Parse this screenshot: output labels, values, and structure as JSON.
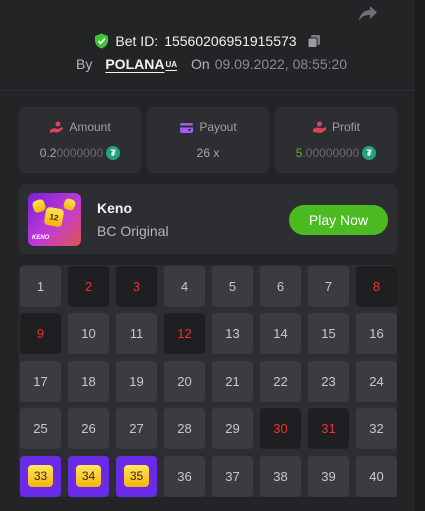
{
  "bet": {
    "id_label": "Bet ID:",
    "id_value": "15560206951915573",
    "by_label": "By",
    "user_name": "POLANA",
    "user_tag": "UA",
    "on_label": "On",
    "date": "09.09.2022, 08:55:20"
  },
  "stats": {
    "amount": {
      "label": "Amount",
      "value_main": "0.2",
      "value_zeros": "0000000",
      "coin": "₮"
    },
    "payout": {
      "label": "Payout",
      "value": "26 x"
    },
    "profit": {
      "label": "Profit",
      "value_main": "5",
      "value_zeros": ".00000000",
      "coin": "₮"
    }
  },
  "game": {
    "name": "Keno",
    "subtitle": "BC Original",
    "play_label": "Play Now",
    "thumb_label": "KENO",
    "thumb_tile": "12"
  },
  "keno": {
    "picked": [
      2,
      3,
      8,
      9,
      12,
      30,
      31
    ],
    "hits": [
      33,
      34,
      35
    ],
    "cells": [
      {
        "n": "1",
        "s": "normal"
      },
      {
        "n": "2",
        "s": "picked"
      },
      {
        "n": "3",
        "s": "picked"
      },
      {
        "n": "4",
        "s": "normal"
      },
      {
        "n": "5",
        "s": "normal"
      },
      {
        "n": "6",
        "s": "normal"
      },
      {
        "n": "7",
        "s": "normal"
      },
      {
        "n": "8",
        "s": "picked"
      },
      {
        "n": "9",
        "s": "picked"
      },
      {
        "n": "10",
        "s": "normal"
      },
      {
        "n": "11",
        "s": "normal"
      },
      {
        "n": "12",
        "s": "picked"
      },
      {
        "n": "13",
        "s": "normal"
      },
      {
        "n": "14",
        "s": "normal"
      },
      {
        "n": "15",
        "s": "normal"
      },
      {
        "n": "16",
        "s": "normal"
      },
      {
        "n": "17",
        "s": "normal"
      },
      {
        "n": "18",
        "s": "normal"
      },
      {
        "n": "19",
        "s": "normal"
      },
      {
        "n": "20",
        "s": "normal"
      },
      {
        "n": "21",
        "s": "normal"
      },
      {
        "n": "22",
        "s": "normal"
      },
      {
        "n": "23",
        "s": "normal"
      },
      {
        "n": "24",
        "s": "normal"
      },
      {
        "n": "25",
        "s": "normal"
      },
      {
        "n": "26",
        "s": "normal"
      },
      {
        "n": "27",
        "s": "normal"
      },
      {
        "n": "28",
        "s": "normal"
      },
      {
        "n": "29",
        "s": "normal"
      },
      {
        "n": "30",
        "s": "picked"
      },
      {
        "n": "31",
        "s": "picked"
      },
      {
        "n": "32",
        "s": "normal"
      },
      {
        "n": "33",
        "s": "hit"
      },
      {
        "n": "34",
        "s": "hit"
      },
      {
        "n": "35",
        "s": "hit"
      },
      {
        "n": "36",
        "s": "normal"
      },
      {
        "n": "37",
        "s": "normal"
      },
      {
        "n": "38",
        "s": "normal"
      },
      {
        "n": "39",
        "s": "normal"
      },
      {
        "n": "40",
        "s": "normal"
      }
    ]
  },
  "colors": {
    "background": "#232426",
    "card": "#2d2e31",
    "cell": "#3b3c41",
    "picked_cell": "#1e1f21",
    "picked_text": "#ee2f32",
    "hit_cell": "#6a2ae8",
    "hit_gem": "#f5c21f",
    "play_button": "#4cba21",
    "profit_green": "#4fbf26",
    "verified_shield": "#3fc43a"
  },
  "icons": {
    "share": "share-arrow-icon",
    "verified": "shield-check-icon",
    "copy": "copy-icon",
    "amount": "coins-hand-icon",
    "payout": "wallet-icon",
    "profit": "profit-hand-icon",
    "coin": "tether-coin-icon"
  }
}
